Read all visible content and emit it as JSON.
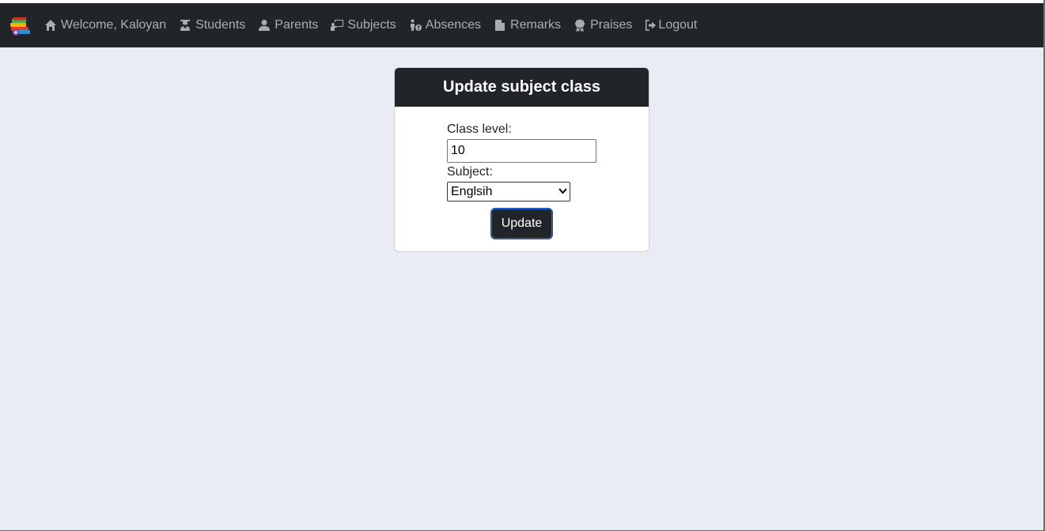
{
  "navbar": {
    "items": [
      {
        "label": "Welcome, Kaloyan",
        "icon": "home-icon"
      },
      {
        "label": "Students",
        "icon": "graduate-icon"
      },
      {
        "label": "Parents",
        "icon": "person-icon"
      },
      {
        "label": "Subjects",
        "icon": "chalkboard-teacher-icon"
      },
      {
        "label": "Absences",
        "icon": "person-question-icon"
      },
      {
        "label": "Remarks",
        "icon": "document-icon"
      },
      {
        "label": "Praises",
        "icon": "award-icon"
      },
      {
        "label": "Logout",
        "icon": "logout-icon"
      }
    ]
  },
  "card": {
    "title": "Update subject class",
    "class_level_label": "Class level:",
    "class_level_value": "10",
    "subject_label": "Subject:",
    "subject_selected": "Englsih",
    "update_label": "Update"
  },
  "colors": {
    "navbar_bg": "#212529",
    "page_bg": "#e9ecf5",
    "button_bg": "#212529"
  }
}
